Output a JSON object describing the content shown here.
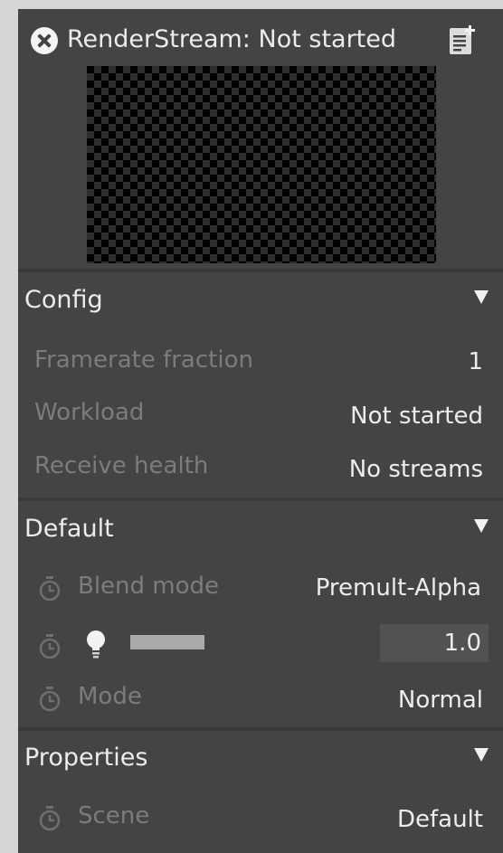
{
  "window": {
    "title": "RenderStream: Not started"
  },
  "icons": {
    "close": "close-circle-icon",
    "note": "note-add-icon",
    "collapse": "triangle-down-icon",
    "keyframe": "stopwatch-icon",
    "light": "lightbulb-icon"
  },
  "colors": {
    "panel": "#444444",
    "divider": "#3a3a3a",
    "label_dim": "#7c7c7c",
    "value": "#ececec",
    "field": "#525252"
  },
  "sections": {
    "config": {
      "title": "Config",
      "rows": [
        {
          "label": "Framerate fraction",
          "value": "1"
        },
        {
          "label": "Workload",
          "value": "Not started"
        },
        {
          "label": "Receive health",
          "value": "No streams"
        }
      ]
    },
    "default": {
      "title": "Default",
      "blend_mode": {
        "label": "Blend mode",
        "value": "Premult-Alpha"
      },
      "brightness": {
        "value": "1.0"
      },
      "mode": {
        "label": "Mode",
        "value": "Normal"
      }
    },
    "properties": {
      "title": "Properties",
      "scene": {
        "label": "Scene",
        "value": "Default"
      }
    }
  }
}
